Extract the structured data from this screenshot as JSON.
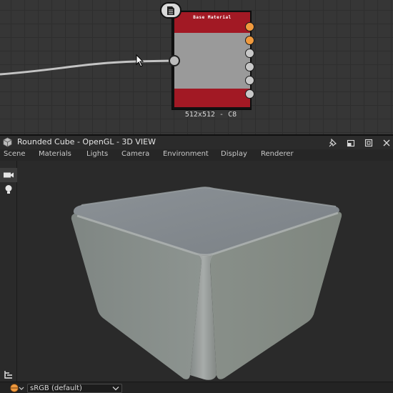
{
  "graph": {
    "node": {
      "title": "Base Material",
      "caption": "512x512 - C8",
      "header_color": "#a21924",
      "output_ports": [
        "orange",
        "orange",
        "grey",
        "grey",
        "grey",
        "grey"
      ],
      "icon": "document-icon"
    },
    "port_accent": "#f09a3e"
  },
  "view": {
    "title": "Rounded Cube - OpenGL - 3D VIEW",
    "title_icon": "cube-icon",
    "window_buttons": [
      "pin-icon",
      "float-icon",
      "maximize-icon",
      "close-icon"
    ],
    "menu": [
      "Scene",
      "Materials",
      "Lights",
      "Camera",
      "Environment",
      "Display",
      "Renderer"
    ],
    "tools": [
      "camera-icon",
      "light-icon"
    ],
    "bottom_tool": "layers-icon"
  },
  "status": {
    "color_space": "sRGB (default)",
    "icon": "shader-ball-icon"
  }
}
